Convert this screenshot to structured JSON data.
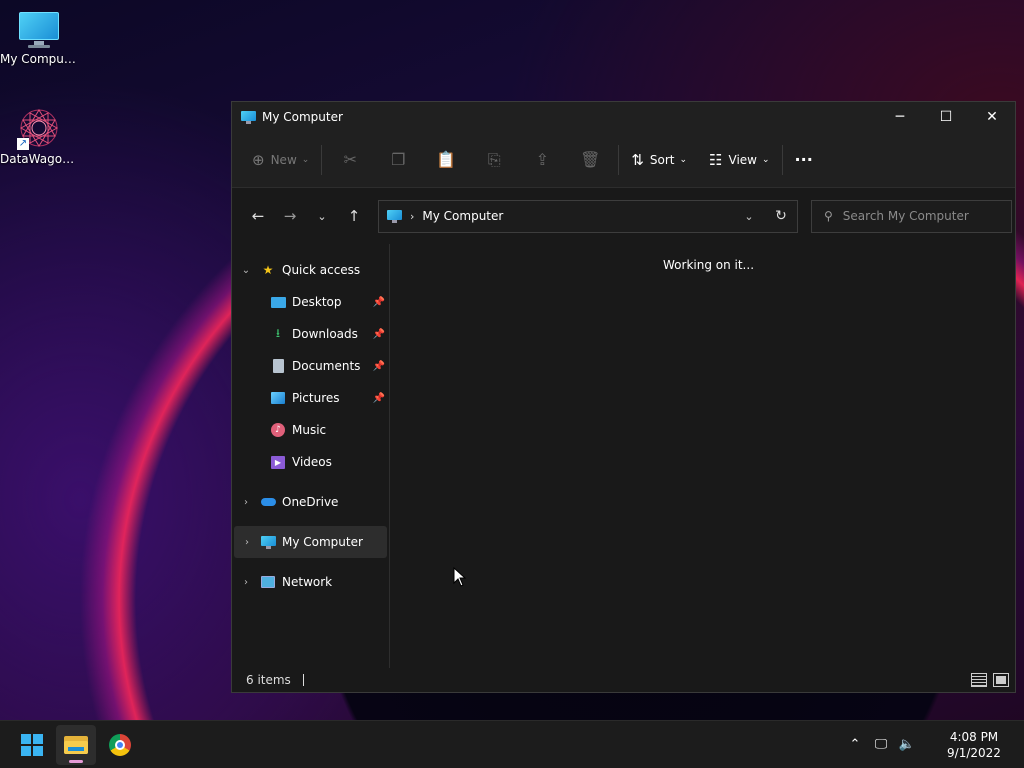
{
  "desktop": {
    "icons": [
      {
        "label": "My Computer",
        "icon": "monitor-icon"
      },
      {
        "label": "DataWagon...",
        "icon": "datawagon-icon"
      }
    ]
  },
  "window": {
    "title": "My Computer",
    "controls": {
      "minimize": "─",
      "maximize": "☐",
      "close": "✕"
    }
  },
  "command_bar": {
    "new_label": "New",
    "sort_label": "Sort",
    "view_label": "View",
    "more_label": "···"
  },
  "address_bar": {
    "path": "My Computer",
    "search_placeholder": "Search My Computer"
  },
  "navigation": {
    "quick_access": "Quick access",
    "items": [
      {
        "label": "Desktop",
        "pinned": true
      },
      {
        "label": "Downloads",
        "pinned": true
      },
      {
        "label": "Documents",
        "pinned": true
      },
      {
        "label": "Pictures",
        "pinned": true
      },
      {
        "label": "Music",
        "pinned": false
      },
      {
        "label": "Videos",
        "pinned": false
      }
    ],
    "onedrive": "OneDrive",
    "my_computer": "My Computer",
    "network": "Network"
  },
  "content": {
    "status_message": "Working on it..."
  },
  "status_bar": {
    "item_count": "6 items"
  },
  "taskbar": {
    "time": "4:08 PM",
    "date": "9/1/2022"
  },
  "colors": {
    "accent": "#3ab4f2",
    "window_bg": "#191919",
    "taskbar_bg": "#1c1c1c"
  }
}
